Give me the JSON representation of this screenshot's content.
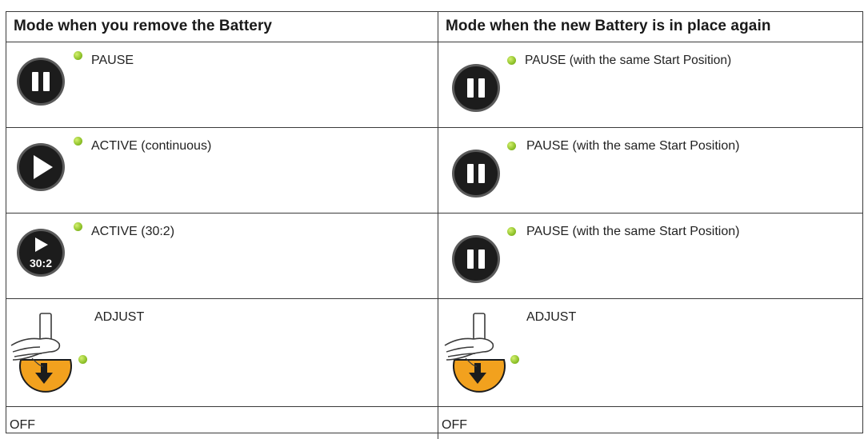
{
  "table": {
    "headers": [
      "Mode when you remove the Battery",
      "Mode when the new Battery is in place again"
    ],
    "rows": [
      {
        "left": {
          "icon": "pause-icon",
          "label": "PAUSE"
        },
        "right": {
          "icon": "pause-icon",
          "label": "PAUSE (with the same Start Position)"
        }
      },
      {
        "left": {
          "icon": "play-icon",
          "label": "ACTIVE (continuous)"
        },
        "right": {
          "icon": "pause-icon",
          "label": "PAUSE (with the same Start Position)"
        }
      },
      {
        "left": {
          "icon": "play-30-2-icon",
          "label": "ACTIVE (30:2)",
          "icon_text": "30:2"
        },
        "right": {
          "icon": "pause-icon",
          "label": "PAUSE (with the same Start Position)"
        }
      },
      {
        "left": {
          "icon": "adjust-hand-icon",
          "label": "ADJUST"
        },
        "right": {
          "icon": "adjust-hand-icon",
          "label": "ADJUST"
        }
      },
      {
        "left": {
          "label": "OFF"
        },
        "right": {
          "label": "OFF"
        }
      }
    ]
  },
  "colors": {
    "button_dark": "#1c1c1c",
    "button_ring": "#5a5a5a",
    "led_green": "#8fc22a",
    "adjust_orange": "#f2a11e"
  }
}
